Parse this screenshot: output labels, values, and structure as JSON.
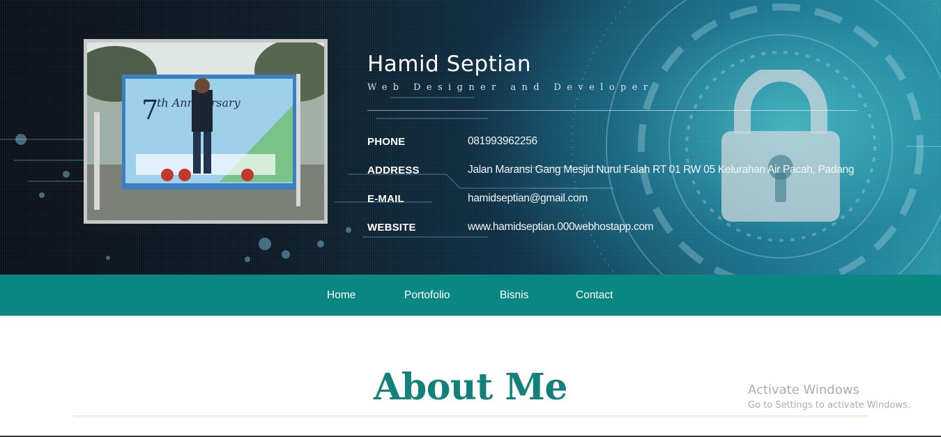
{
  "profile": {
    "name": "Hamid Septian",
    "role": "Web Designer and Developer",
    "photo_alt": "Portrait photo at 7th Anniversary event banner"
  },
  "contact": [
    {
      "label": "PHONE",
      "value": "081993962256"
    },
    {
      "label": "ADDRESS",
      "value": "Jalan Maransi Gang Mesjid Nurul Falah RT 01 RW 05 Kelurahan Air Pacah, Padang"
    },
    {
      "label": "E-MAIL",
      "value": "hamidseptian@gmail.com"
    },
    {
      "label": "WEBSITE",
      "value": "www.hamidseptian.000webhostapp.com"
    }
  ],
  "nav": {
    "items": [
      {
        "label": "Home"
      },
      {
        "label": "Portofolio"
      },
      {
        "label": "Bisnis"
      },
      {
        "label": "Contact"
      }
    ]
  },
  "about": {
    "title": "About Me"
  },
  "watermark": {
    "title": "Activate Windows",
    "subtitle": "Go to Settings to activate Windows."
  },
  "icons": [
    "padlock-icon"
  ],
  "colors": {
    "nav_bg": "#0b8783",
    "about_title": "#13807c",
    "frame": "#c8c8c8"
  }
}
